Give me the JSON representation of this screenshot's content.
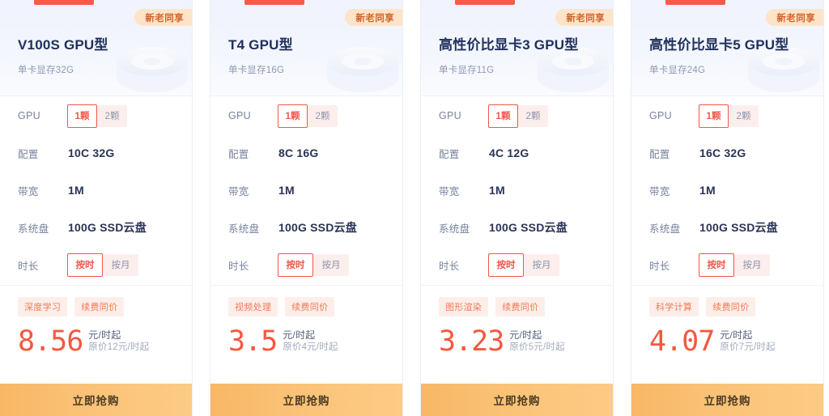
{
  "page": {
    "badge_label": "新老同享",
    "buy_label": "立即抢购",
    "spec_labels": {
      "gpu": "GPU",
      "config": "配置",
      "bandwidth": "带宽",
      "disk": "系统盘",
      "duration": "时长"
    },
    "gpu_options": [
      "1颗",
      "2颗"
    ],
    "duration_options": [
      "按时",
      "按月"
    ],
    "colors": {
      "accent_red": "#f4583f",
      "select_border": "#f0564a",
      "button_gradient_start": "#f8b765",
      "button_gradient_end": "#fccb85",
      "badge_bg": "#fde4c8",
      "badge_text": "#d2622d",
      "tag_bg": "#fdeeea",
      "tag_text": "#ef7a55",
      "title_text": "#20305c",
      "header_bg": "#f0f3fd"
    }
  },
  "cards": [
    {
      "title": "V100S GPU型",
      "subtitle": "单卡显存32G",
      "badge": "新老同享",
      "gpu_selected": "1颗",
      "config": "10C 32G",
      "bandwidth": "1M",
      "disk": "100G SSD云盘",
      "duration_selected": "按时",
      "tags": [
        "深度学习",
        "续费同价"
      ],
      "price": "8.56",
      "price_unit": "元/时起",
      "price_original": "原价12元/时起",
      "buy_label": "立即抢购"
    },
    {
      "title": "T4 GPU型",
      "subtitle": "单卡显存16G",
      "badge": "新老同享",
      "gpu_selected": "1颗",
      "config": "8C 16G",
      "bandwidth": "1M",
      "disk": "100G SSD云盘",
      "duration_selected": "按时",
      "tags": [
        "视频处理",
        "续费同价"
      ],
      "price": "3.5",
      "price_unit": "元/时起",
      "price_original": "原价4元/时起",
      "buy_label": "立即抢购"
    },
    {
      "title": "高性价比显卡3 GPU型",
      "subtitle": "单卡显存11G",
      "badge": "新老同享",
      "gpu_selected": "1颗",
      "config": "4C 12G",
      "bandwidth": "1M",
      "disk": "100G SSD云盘",
      "duration_selected": "按时",
      "tags": [
        "图形渲染",
        "续费同价"
      ],
      "price": "3.23",
      "price_unit": "元/时起",
      "price_original": "原价5元/时起",
      "buy_label": "立即抢购"
    },
    {
      "title": "高性价比显卡5 GPU型",
      "subtitle": "单卡显存24G",
      "badge": "新老同享",
      "gpu_selected": "1颗",
      "config": "16C 32G",
      "bandwidth": "1M",
      "disk": "100G SSD云盘",
      "duration_selected": "按时",
      "tags": [
        "科学计算",
        "续费同价"
      ],
      "price": "4.07",
      "price_unit": "元/时起",
      "price_original": "原价7元/时起",
      "buy_label": "立即抢购"
    }
  ]
}
